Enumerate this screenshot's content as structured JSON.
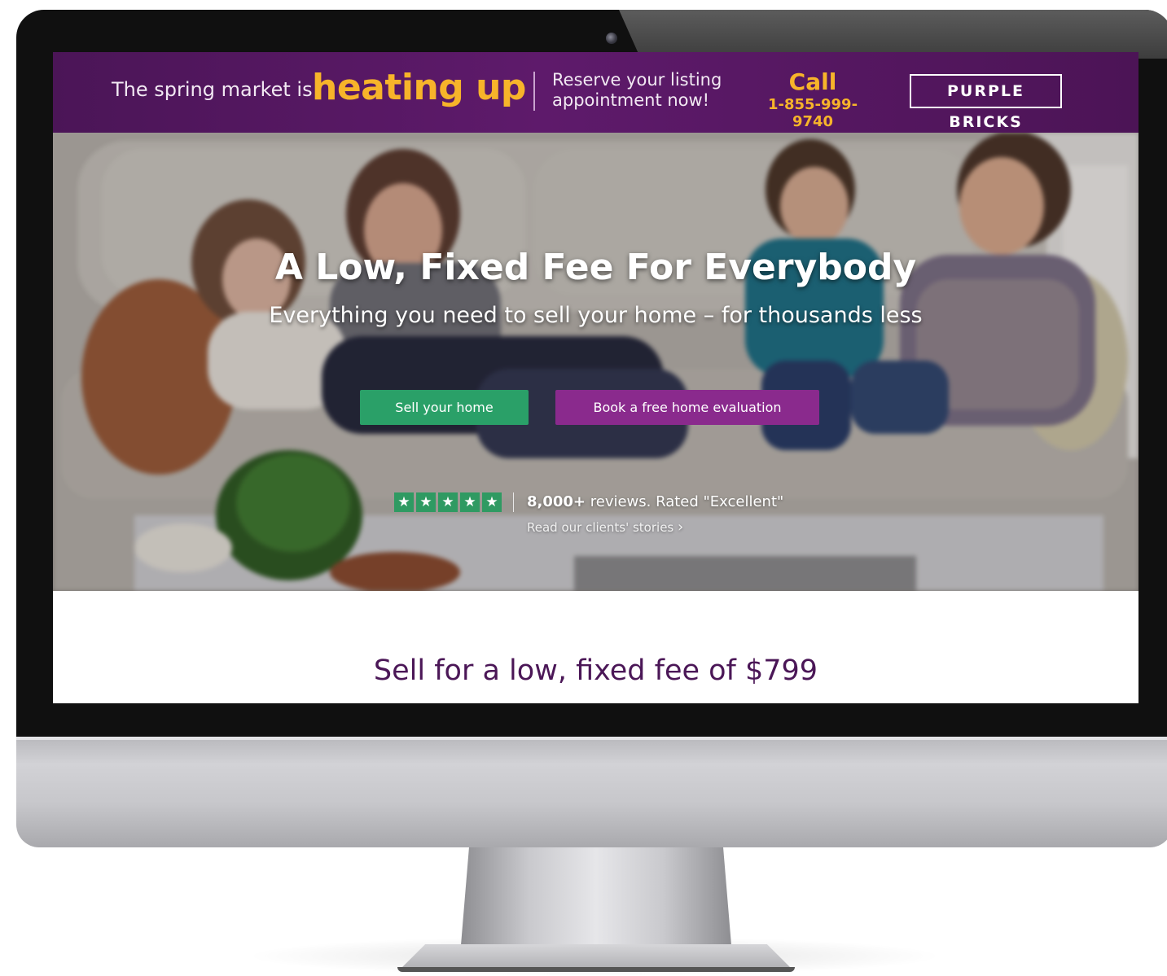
{
  "promo": {
    "lead": "The spring market is",
    "highlight": "heating up",
    "reserve_line1": "Reserve your listing",
    "reserve_line2": "appointment now!",
    "call_label": "Call",
    "phone": "1-855-999-9740",
    "logo_text": "PURPLE BRICKS"
  },
  "hero": {
    "title": "A Low, Fixed Fee For Everybody",
    "subtitle": "Everything you need to sell your home – for thousands less",
    "sell_button": "Sell your home",
    "book_button": "Book a free home evaluation",
    "star_count": 5,
    "star_glyph": "★",
    "reviews_bold": "8,000+",
    "reviews_rest": " reviews. Rated \"Excellent\"",
    "stories_link": "Read our clients' stories",
    "chevron": "›"
  },
  "section": {
    "fee_heading": "Sell for a low, fixed fee of $799"
  },
  "colors": {
    "brand_purple": "#5e1a6b",
    "accent_gold": "#f7b42a",
    "sell_green": "#2aa068",
    "book_purple": "#8a2a8d"
  }
}
